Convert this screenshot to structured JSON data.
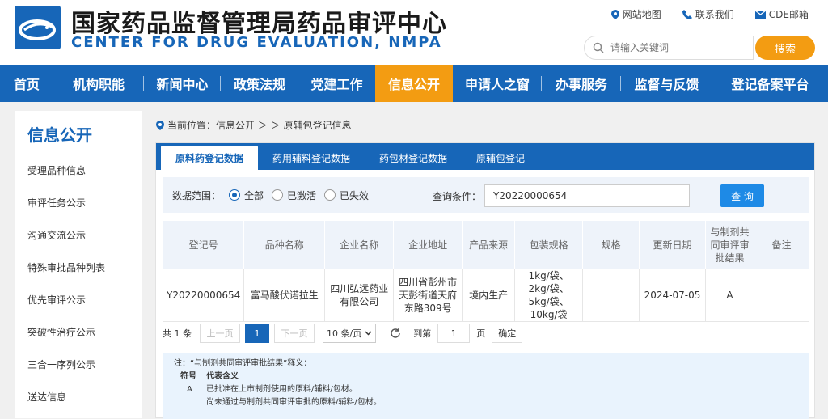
{
  "header": {
    "title_cn": "国家药品监督管理局药品审评中心",
    "title_en": "CENTER FOR DRUG EVALUATION, NMPA",
    "links": [
      "网站地图",
      "联系我们",
      "CDE邮箱"
    ],
    "search_placeholder": "请输入关键词",
    "search_button": "搜索"
  },
  "nav": {
    "items": [
      "首页",
      "机构职能",
      "新闻中心",
      "政策法规",
      "党建工作",
      "信息公开",
      "申请人之窗",
      "办事服务",
      "监督与反馈",
      "登记备案平台"
    ],
    "active": "信息公开"
  },
  "sidebar": {
    "title": "信息公开",
    "items": [
      "受理品种信息",
      "审评任务公示",
      "沟通交流公示",
      "特殊审批品种列表",
      "优先审评公示",
      "突破性治疗公示",
      "三合一序列公示",
      "送达信息"
    ]
  },
  "breadcrumb": "当前位置：信息公开 ＞ ＞ 原辅包登记信息",
  "tabs": [
    "原料药登记数据",
    "药用辅料登记数据",
    "药包材登记数据",
    "原辅包登记"
  ],
  "filter": {
    "range_label": "数据范围：",
    "options": [
      "全部",
      "已激活",
      "已失效"
    ],
    "selected": "全部",
    "query_label": "查询条件：",
    "query_value": "Y20220000654",
    "query_button": "查 询"
  },
  "table": {
    "headers": [
      "登记号",
      "品种名称",
      "企业名称",
      "企业地址",
      "产品来源",
      "包装规格",
      "规格",
      "更新日期",
      "与制剂共同审评审批结果",
      "备注"
    ],
    "rows": [
      [
        "Y20220000654",
        "富马酸伏诺拉生",
        "四川弘远药业有限公司",
        "四川省彭州市天彭街道天府东路309号",
        "境内生产",
        "1kg/袋、2kg/袋、5kg/袋、10kg/袋",
        "",
        "2024-07-05",
        "A",
        ""
      ]
    ]
  },
  "pager": {
    "total": "共 1 条",
    "prev": "上一页",
    "current": "1",
    "next": "下一页",
    "page_size": "10 条/页",
    "goto_label": "到第",
    "goto_value": "1",
    "page_unit": "页",
    "confirm": "确定"
  },
  "note": {
    "title": "注：“与制剂共同审评审批结果”释义：",
    "header_symbol": "符号",
    "header_meaning": "代表含义",
    "rows": [
      {
        "symbol": "A",
        "meaning": "已批准在上市制剂使用的原料/辅料/包材。"
      },
      {
        "symbol": "I",
        "meaning": "尚未通过与制剂共同审评审批的原料/辅料/包材。"
      }
    ]
  },
  "colors": {
    "primary": "#1766b8",
    "accent": "#f39c12",
    "query_button": "#1e8ae6"
  },
  "icons": [
    "location-pin-icon",
    "phone-icon",
    "mail-icon",
    "search-icon",
    "refresh-icon",
    "chevron-down-icon"
  ]
}
